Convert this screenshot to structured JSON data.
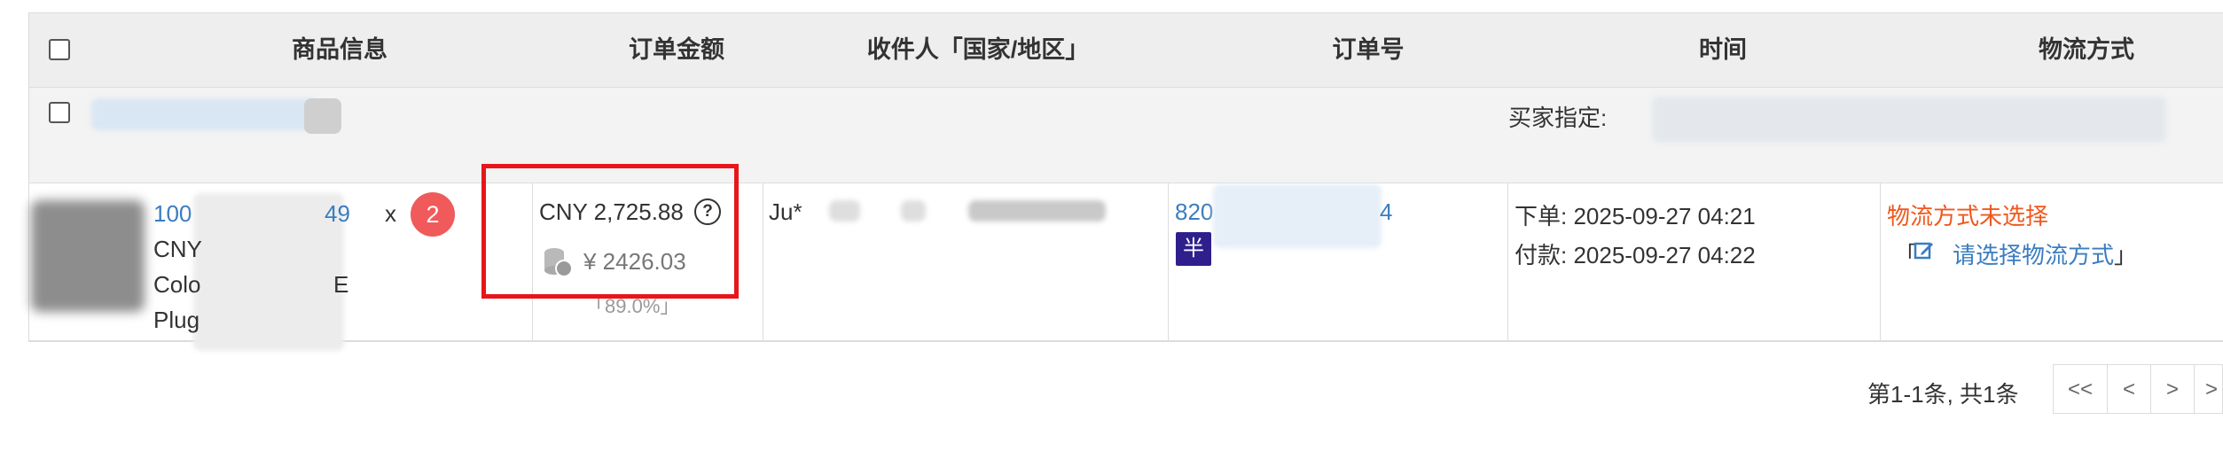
{
  "table": {
    "headers": {
      "product": "商品信息",
      "amount": "订单金额",
      "recipient": "收件人「国家/地区」",
      "order_no": "订单号",
      "time": "时间",
      "shipping": "物流方式"
    }
  },
  "group": {
    "buyer_label": "买家指定:"
  },
  "order": {
    "product_id_prefix": "100",
    "product_id_suffix": "49",
    "multiply": "x",
    "quantity": "2",
    "currency_line": "CNY",
    "color_line": "Colo",
    "plug_line": "Plug",
    "tail_char": "E",
    "amount": "CNY 2,725.88",
    "help_icon": "?",
    "coin_icon": "coins-icon",
    "rmb_amount": "¥ 2426.03",
    "percent": "「89.0%」",
    "recipient_prefix": "Ju*",
    "order_no_prefix": "820",
    "order_no_suffix": "4",
    "half_tag": "半",
    "placed": "下单: 2025-09-27 04:21",
    "paid": "付款: 2025-09-27 04:22",
    "shipping_status": "物流方式未选择",
    "choose_shipping": "请选择物流方式",
    "bracket_open": "「",
    "bracket_close": "」"
  },
  "colors": {
    "accent_blue": "#3a7dc0",
    "warning_orange": "#f0571c",
    "highlight_red": "#e8151b",
    "badge_red": "#f05a5a"
  },
  "pagination": {
    "summary": "第1-1条, 共1条",
    "first": "<<",
    "prev": "<",
    "next": ">",
    "last": ">"
  }
}
